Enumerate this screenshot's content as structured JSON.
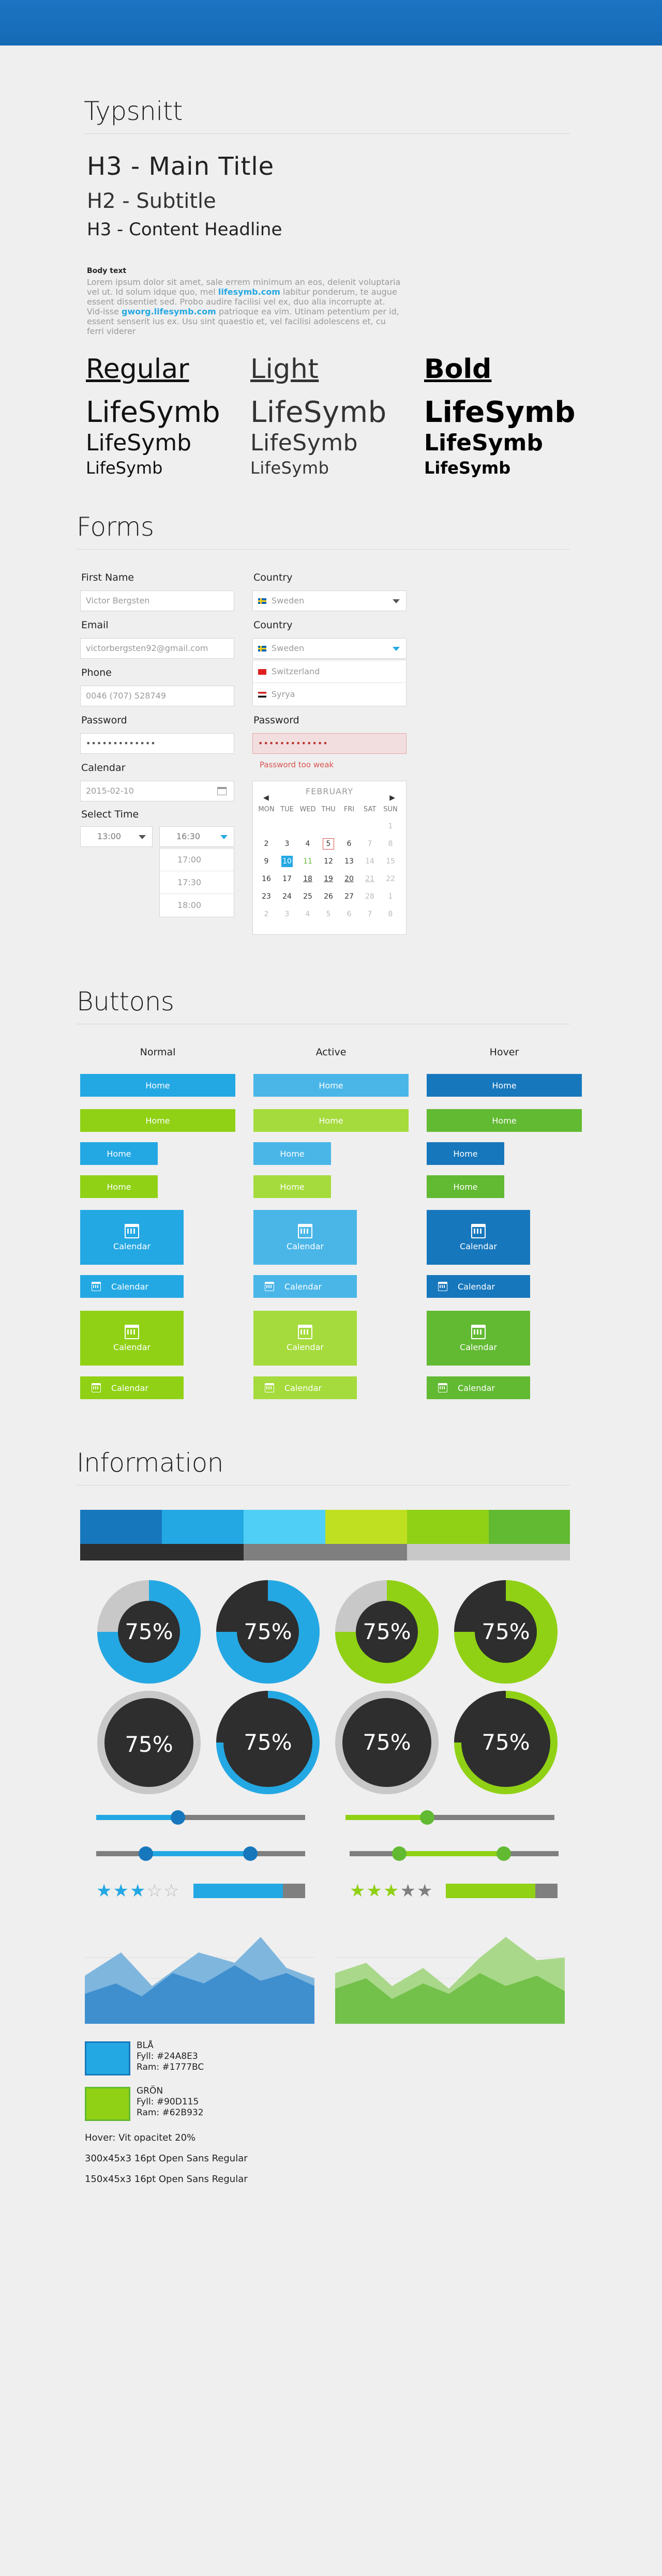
{
  "colors": {
    "blue": "#24A8E3",
    "blue_dark": "#1777BC",
    "green": "#90D115",
    "green_dark": "#62B932",
    "cyan": "#4FCFF5",
    "lime": "#BFE021",
    "grey": "#7f7f7f",
    "dark": "#2e2e2e"
  },
  "typography": {
    "section_title": "Typsnitt",
    "h3_main": "H3 - Main Title",
    "h2_subtitle": "H2 - Subtitle",
    "h3_content": "H3 - Content Headline",
    "body_heading": "Body text",
    "body_p1": "Lorem ipsum dolor sit amet, sale errem minimum an eos, delenit voluptaria vel ut. Id solum idque quo, mel ",
    "body_link1": "lifesymb.com",
    "body_p2": " labitur ponderum, te augue essent dissentiet sed. Probo audire facilisi vel ex, duo alia incorrupte at. Vid-isse ",
    "body_link2": "gworg.lifesymb.com",
    "body_p3": " patrioque ea vim. Utinam petentium per id, essent senserit ius ex. Usu sint quaestio et, vel facilisi adolescens et, cu ferri viderer",
    "weights": [
      {
        "title": "Regular",
        "samples": [
          "LifeSymb",
          "LifeSymb",
          "LifeSymb"
        ]
      },
      {
        "title": "Light",
        "samples": [
          "LifeSymb",
          "LifeSymb",
          "LifeSymb"
        ]
      },
      {
        "title": "Bold",
        "samples": [
          "LifeSymb",
          "LifeSymb",
          "LifeSymb"
        ]
      }
    ]
  },
  "forms": {
    "section_title": "Forms",
    "first_name": {
      "label": "First Name",
      "placeholder": "Victor Bergsten"
    },
    "email": {
      "label": "Email",
      "placeholder": "victorbergsten92@gmail.com"
    },
    "phone": {
      "label": "Phone",
      "placeholder": "0046 (707) 528749"
    },
    "password": {
      "label": "Password",
      "value": "•••••••••••••"
    },
    "calendar": {
      "label": "Calendar",
      "value": "2015-02-10"
    },
    "select_time": {
      "label": "Select Time",
      "value_a": "13:00",
      "value_b": "16:30",
      "options": [
        "17:00",
        "17:30",
        "18:00"
      ]
    },
    "country1": {
      "label": "Country",
      "value": "Sweden"
    },
    "country2": {
      "label": "Country",
      "value": "Sweden",
      "options": [
        "Switzerland",
        "Syrya"
      ]
    },
    "password_err": {
      "label": "Password",
      "value": "•••••••••••••",
      "error": "Password too weak"
    },
    "datepicker": {
      "month": "FEBRUARY",
      "days": [
        "MON",
        "TUE",
        "WED",
        "THU",
        "FRI",
        "SAT",
        "SUN"
      ],
      "weeks": [
        [
          "",
          "",
          "",
          "",
          "",
          "",
          "1"
        ],
        [
          "2",
          "3",
          "4",
          "5",
          "6",
          "7",
          "8"
        ],
        [
          "9",
          "10",
          "11",
          "12",
          "13",
          "14",
          "15"
        ],
        [
          "16",
          "17",
          "18",
          "19",
          "20",
          "21",
          "22"
        ],
        [
          "23",
          "24",
          "25",
          "26",
          "27",
          "28",
          "1"
        ],
        [
          "2",
          "3",
          "4",
          "5",
          "6",
          "7",
          "8"
        ]
      ]
    }
  },
  "buttons": {
    "section_title": "Buttons",
    "columns": [
      "Normal",
      "Active",
      "Hover"
    ],
    "home_label": "Home",
    "calendar_label": "Calendar"
  },
  "information": {
    "section_title": "Information",
    "donut_value": "75%",
    "legend": [
      {
        "name": "BLÅ",
        "fill": "Fyll: #24A8E3",
        "frame": "Ram: #1777BC"
      },
      {
        "name": "GRÖN",
        "fill": "Fyll: #90D115",
        "frame": "Ram: #62B932"
      }
    ],
    "notes": [
      "Hover: Vit opacitet 20%",
      "300x45x3  16pt  Open Sans Regular",
      "150x45x3  16pt  Open Sans Regular"
    ],
    "ratings": {
      "blue_filled": 3,
      "green_filled": 3,
      "total": 5,
      "blue_bar": 0.8,
      "green_bar": 0.8
    },
    "sliders": {
      "single": 0.4,
      "range": [
        0.25,
        0.75
      ]
    }
  }
}
